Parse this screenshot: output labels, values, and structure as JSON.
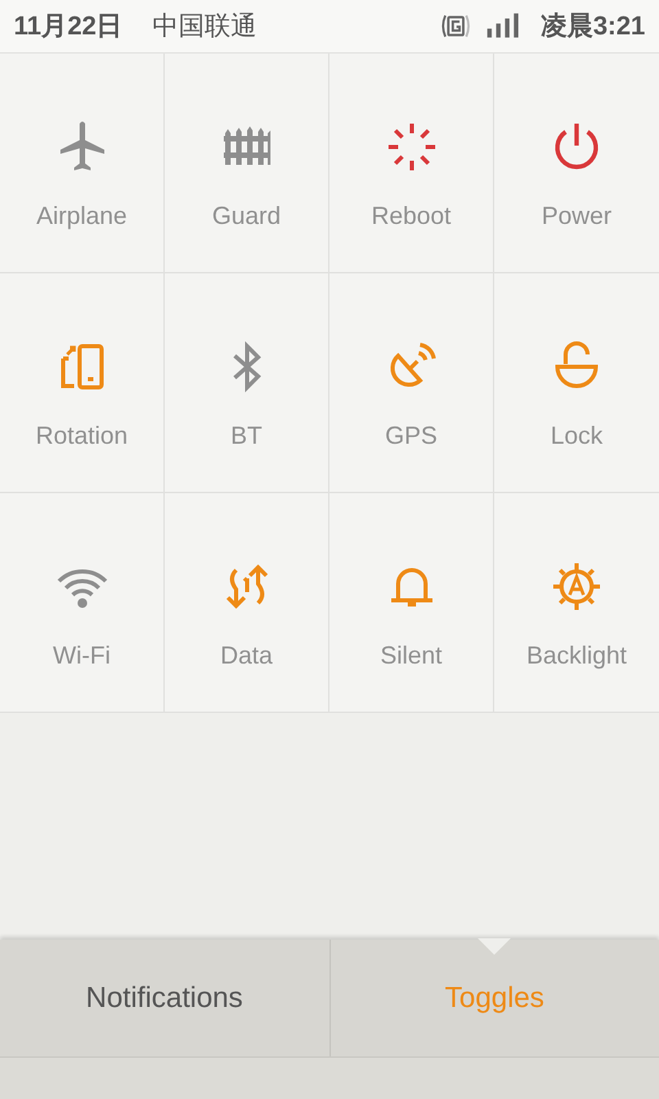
{
  "status_bar": {
    "date": "11月22日",
    "carrier": "中国联通",
    "time": "凌晨3:21"
  },
  "toggles": [
    {
      "label": "Airplane",
      "kind": "toggle",
      "on": false
    },
    {
      "label": "Guard",
      "kind": "toggle",
      "on": false
    },
    {
      "label": "Reboot",
      "kind": "action"
    },
    {
      "label": "Power",
      "kind": "action"
    },
    {
      "label": "Rotation",
      "kind": "toggle",
      "on": true
    },
    {
      "label": "BT",
      "kind": "toggle",
      "on": false
    },
    {
      "label": "GPS",
      "kind": "toggle",
      "on": true
    },
    {
      "label": "Lock",
      "kind": "toggle",
      "on": true
    },
    {
      "label": "Wi-Fi",
      "kind": "toggle",
      "on": false
    },
    {
      "label": "Data",
      "kind": "toggle",
      "on": true
    },
    {
      "label": "Silent",
      "kind": "toggle",
      "on": true
    },
    {
      "label": "Backlight",
      "kind": "toggle",
      "on": true
    }
  ],
  "tabs": [
    {
      "label": "Notifications",
      "selected": false
    },
    {
      "label": "Toggles",
      "selected": true
    }
  ]
}
